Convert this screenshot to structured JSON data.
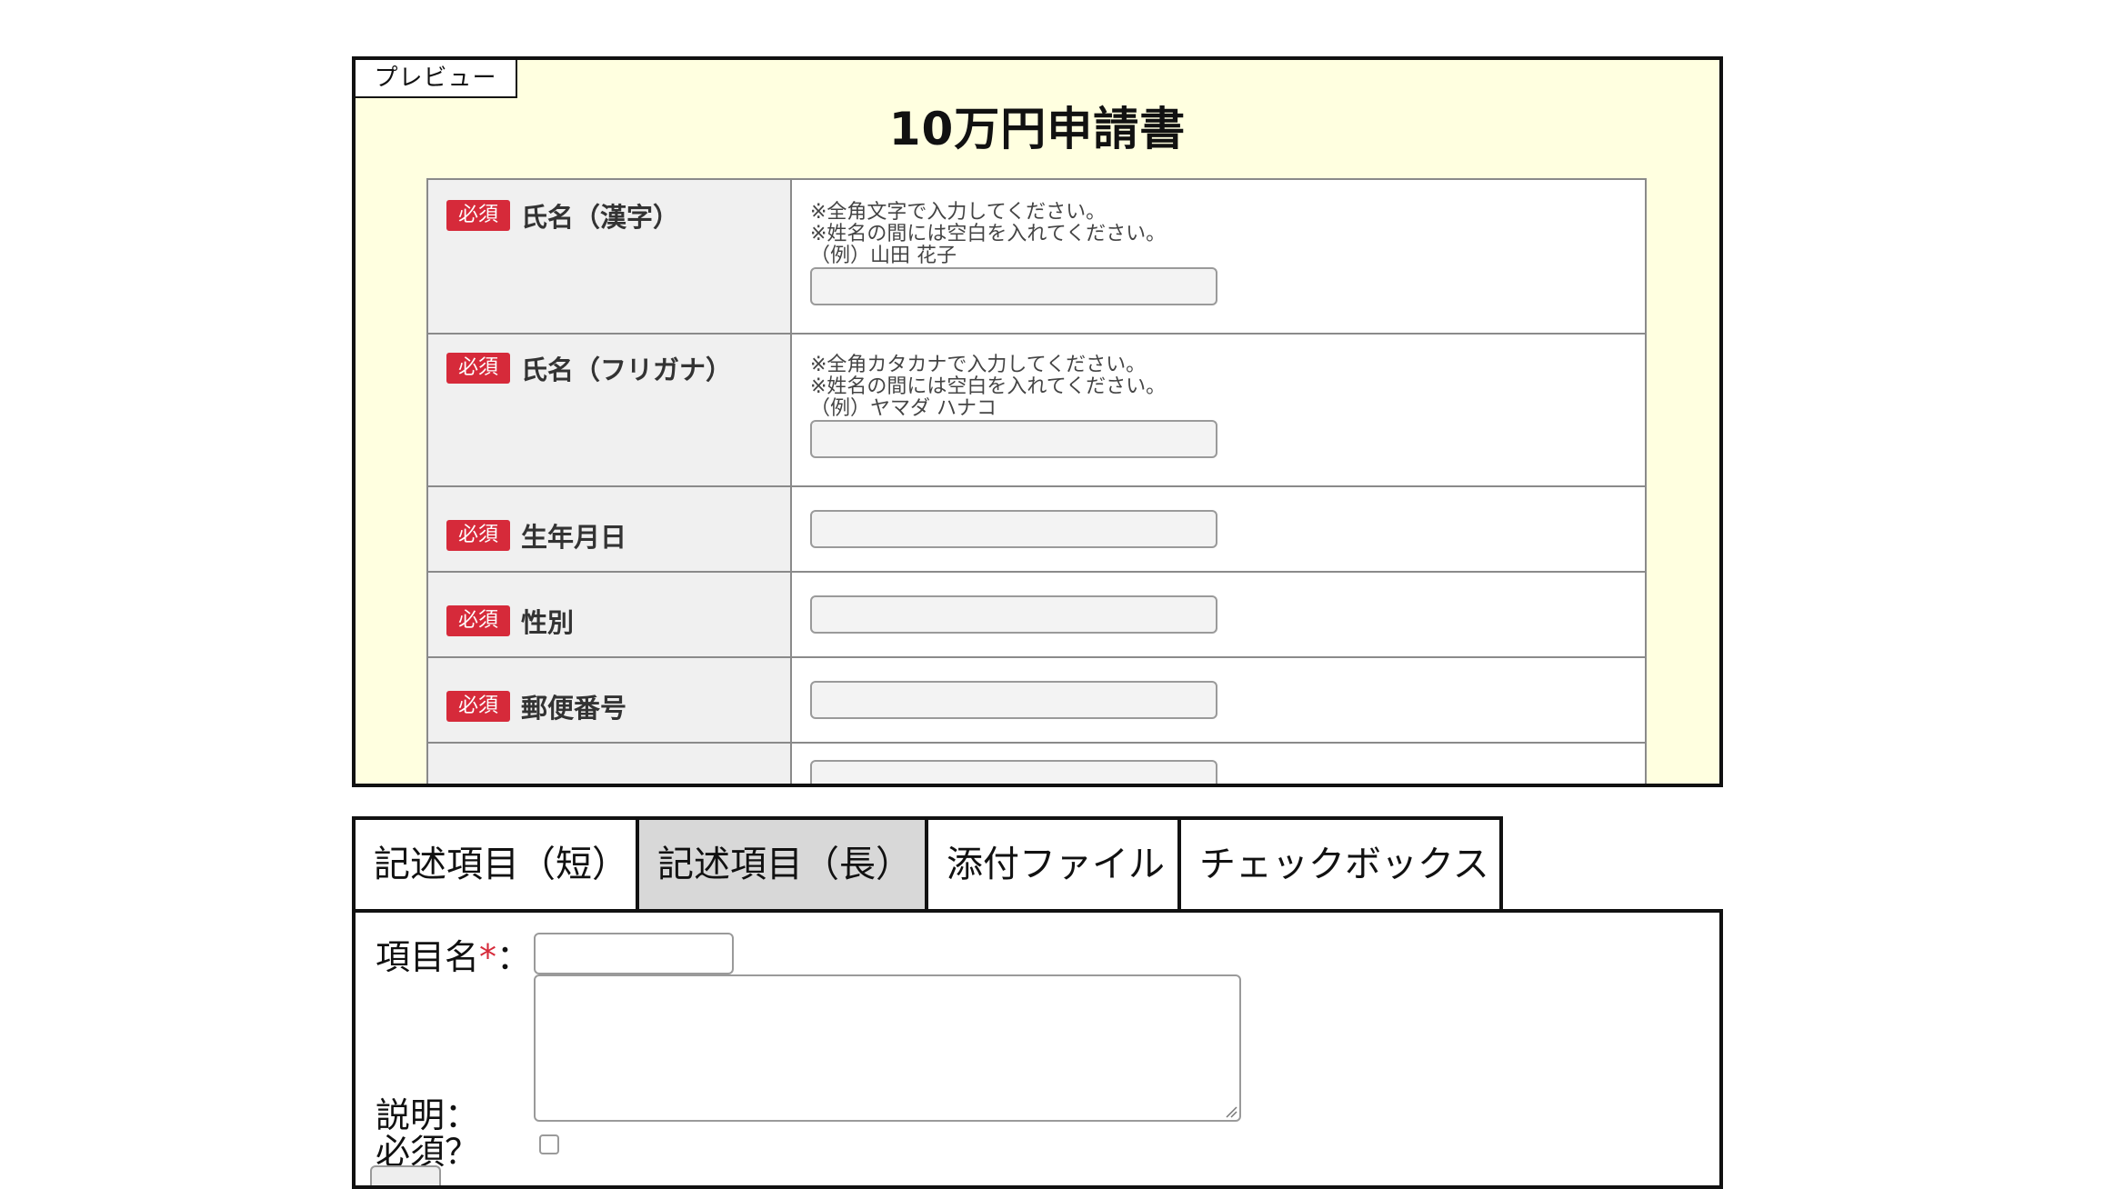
{
  "preview": {
    "tag": "プレビュー",
    "title": "10万円申請書",
    "required_badge": "必須",
    "fields": [
      {
        "label": "氏名（漢字）",
        "hints": [
          "※全角文字で入力してください。",
          "※姓名の間には空白を入れてください。",
          "（例）山田 花子"
        ]
      },
      {
        "label": "氏名（フリガナ）",
        "hints": [
          "※全角カタカナで入力してください。",
          "※姓名の間には空白を入れてください。",
          "（例）ヤマダ ハナコ"
        ]
      },
      {
        "label": "生年月日"
      },
      {
        "label": "性別"
      },
      {
        "label": "郵便番号"
      }
    ]
  },
  "tabs": [
    {
      "label": "記述項目（短）",
      "active": false
    },
    {
      "label": "記述項目（長）",
      "active": true
    },
    {
      "label": "添付ファイル",
      "active": false
    },
    {
      "label": "チェックボックス",
      "active": false
    }
  ],
  "editor": {
    "name_label": "項目名",
    "required_mark": "*",
    "colon": "：",
    "description_label": "説明：",
    "required_label": "必須？",
    "name_value": "",
    "description_value": "",
    "required_checked": false
  },
  "colors": {
    "preview_bg": "#ffffe0",
    "badge": "#d62a3a",
    "active_tab": "#d8d8d8"
  }
}
